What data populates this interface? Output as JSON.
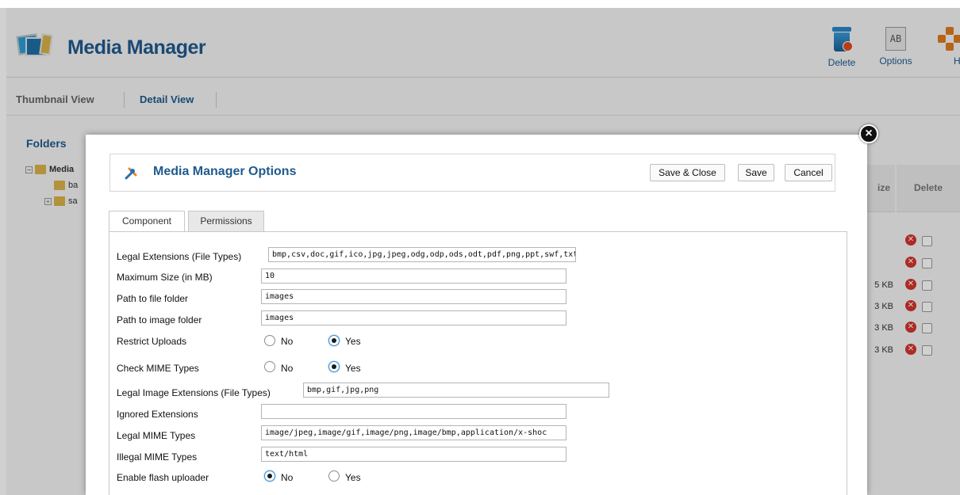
{
  "header": {
    "title": "Media Manager"
  },
  "toolbar": {
    "delete_label": "Delete",
    "options_label": "Options",
    "options_icon_text": "AB",
    "help_label": "Hel"
  },
  "subnav": {
    "thumbnail_view": "Thumbnail View",
    "detail_view": "Detail View"
  },
  "folders": {
    "title": "Folders",
    "items": [
      "Media",
      "ba",
      "sa"
    ]
  },
  "file_table": {
    "size_header": "ize",
    "delete_header": "Delete",
    "rows": [
      "",
      "",
      "5 KB",
      "3 KB",
      "3 KB",
      "3 KB"
    ]
  },
  "modal": {
    "title": "Media Manager Options",
    "buttons": {
      "save_close": "Save & Close",
      "save": "Save",
      "cancel": "Cancel"
    },
    "tabs": [
      "Component",
      "Permissions"
    ]
  },
  "form": {
    "legal_extensions": {
      "label": "Legal Extensions (File Types)",
      "value": "bmp,csv,doc,gif,ico,jpg,jpeg,odg,odp,ods,odt,pdf,png,ppt,swf,txt"
    },
    "max_size": {
      "label": "Maximum Size (in MB)",
      "value": "10"
    },
    "file_path": {
      "label": "Path to file folder",
      "value": "images"
    },
    "image_path": {
      "label": "Path to image folder",
      "value": "images"
    },
    "restrict_uploads": {
      "label": "Restrict Uploads",
      "options": [
        "No",
        "Yes"
      ],
      "selected": "Yes"
    },
    "check_mime": {
      "label": "Check MIME Types",
      "options": [
        "No",
        "Yes"
      ],
      "selected": "Yes"
    },
    "legal_image_extensions": {
      "label": "Legal Image Extensions (File Types)",
      "value": "bmp,gif,jpg,png"
    },
    "ignored_extensions": {
      "label": "Ignored Extensions",
      "value": ""
    },
    "legal_mime": {
      "label": "Legal MIME Types",
      "value": "image/jpeg,image/gif,image/png,image/bmp,application/x-shoc"
    },
    "illegal_mime": {
      "label": "Illegal MIME Types",
      "value": "text/html"
    },
    "flash_uploader": {
      "label": "Enable flash uploader",
      "options": [
        "No",
        "Yes"
      ],
      "selected": "No"
    }
  },
  "colors": {
    "accent": "#1f5a8e",
    "delete_red": "#d3342e"
  }
}
